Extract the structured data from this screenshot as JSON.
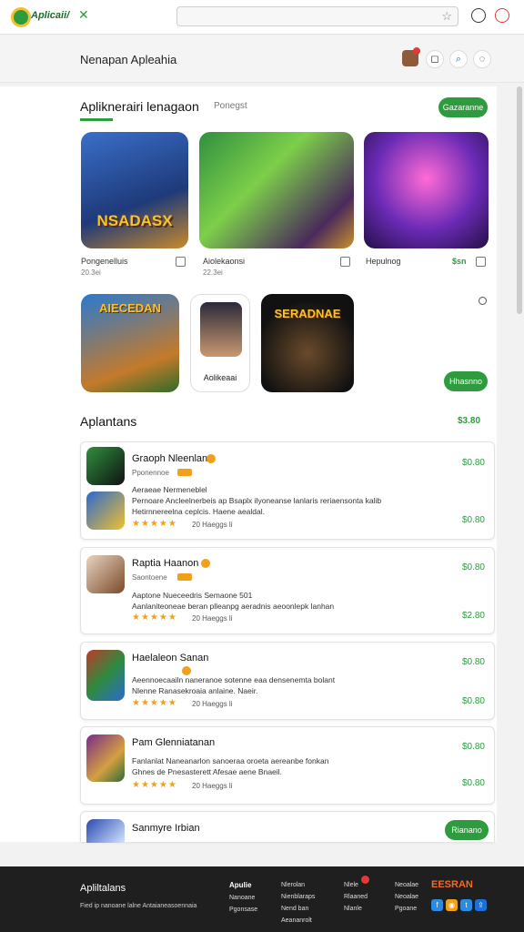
{
  "browser": {
    "logo_text": "Aplicaii/",
    "close": "✕",
    "star": "☆"
  },
  "header": {
    "title": "Nenapan Apleahia"
  },
  "featured": {
    "title": "Apliknerairi lenagaon",
    "subtitle": "Ponegst",
    "button": "Gazaranne",
    "tiles_row1": [
      {
        "art": "NSADASX",
        "caption": "Pongenelluis",
        "sub": "20.3ei"
      },
      {
        "art": "",
        "caption": "Aiolekaonsi",
        "sub": "22.3ei"
      },
      {
        "art": "",
        "caption": "Hepulnog",
        "price": "$sn"
      }
    ],
    "tiles_row2": [
      {
        "art": "AIECEDAN"
      },
      {
        "caption": "Aolikeaai"
      },
      {
        "art": "SERADNAE"
      }
    ],
    "button2": "Hhasnno"
  },
  "apps": {
    "title": "Aplantans",
    "total": "$3.80",
    "items": [
      {
        "name": "Graoph Nleenlan",
        "sub": "Pponennoe",
        "desc1": "Aeraeae Nermeneblel",
        "desc2": "Pernoare Ancleelnerbeis ap Bsaplx ilyoneanse lanlaris reriaensonta kalib",
        "desc3": "Hetirnnereelna ceplcis. Haene aealdal.",
        "rating": "20 Haeggs li",
        "price1": "$0.80",
        "price2": "$0.80",
        "stars": "★★★★★"
      },
      {
        "name": "Raptia Haanon",
        "sub": "Saontoene",
        "desc1": "Aaptone Nueceedris          Semaone 501",
        "desc2": "Aanlaniteoneae beran plleanpg aeradnis aeoonlepk lanhan",
        "desc3": "",
        "rating": "20 Haeggs li",
        "price1": "$0.80",
        "price2": "$2.80",
        "stars": "★★★★★"
      },
      {
        "name": "Haelaleon Sanan",
        "sub": "",
        "desc1": "Aeennoecaailn naneranoe sotenne eaa densenemta bolant",
        "desc2": "Nlenne Ranasekroaia anlaine. Naeir.",
        "desc3": "",
        "rating": "20 Haeggs li",
        "price1": "$0.80",
        "price2": "$0.80",
        "stars": "★★★★★"
      },
      {
        "name": "Pam Glenniatanan",
        "sub": "",
        "desc1": "Fanlanlat Naneanarlon sanoeraa oroeta aereanbe fonkan",
        "desc2": "Ghnes de Pnesasterett Afesae aene Bnaeil.",
        "desc3": "",
        "rating": "20 Haeggs li",
        "price1": "$0.80",
        "price2": "$0.80",
        "stars": "★★★★★"
      },
      {
        "name": "Sanmyre Irbian",
        "button": "Rianano"
      }
    ]
  },
  "footer": {
    "title": "Apliltalans",
    "text": "Fied ip nanoane lalne Antaianeasoennaia",
    "col1": {
      "head": "Apulie",
      "a": "Nanoane",
      "b": "Pgonsase"
    },
    "col2": {
      "head": "Nlerolan",
      "a": "Nienblaraps",
      "b": "Nend ban",
      "c": "Aeananrolt"
    },
    "col3": {
      "head": "Nlele",
      "a": "Rlaaned",
      "b": "Nlanle"
    },
    "col4": {
      "head": "Neoalae",
      "a": "Neoalae",
      "b": "Pgoane"
    },
    "brand": "EESRAN"
  }
}
